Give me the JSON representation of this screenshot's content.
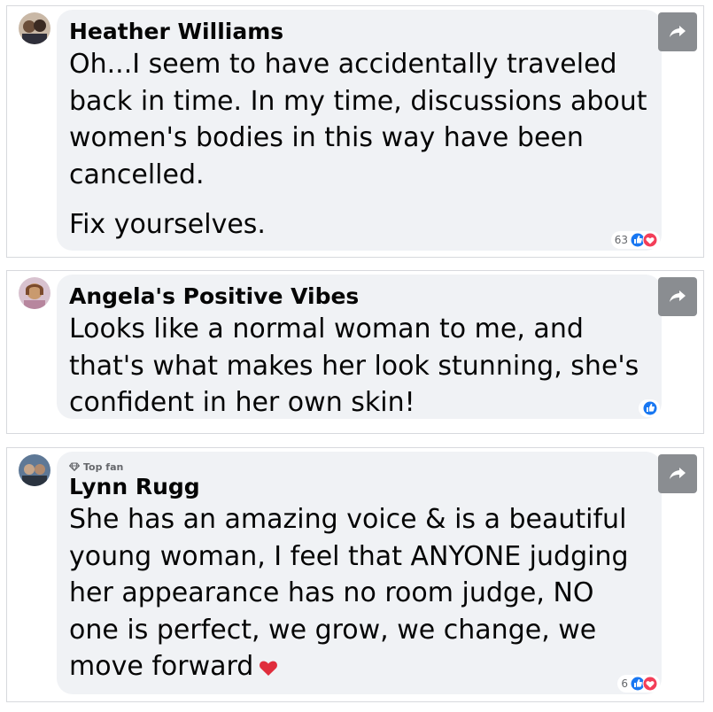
{
  "comments": [
    {
      "author": "Heather Williams",
      "paragraphs": [
        "Oh...I seem to have accidentally traveled back in time. In my time, discussions about women's bodies in this way have been cancelled.",
        "Fix yourselves."
      ],
      "reaction_count": "63",
      "reaction_icons": [
        "like-icon",
        "love-icon"
      ]
    },
    {
      "author": "Angela's Positive Vibes",
      "paragraphs": [
        "Looks like a normal woman to me, and that's what makes her look stunning, she's confident in her own skin!"
      ],
      "reaction_count": "",
      "reaction_icons": [
        "like-icon"
      ]
    },
    {
      "badge": "Top fan",
      "author": "Lynn Rugg",
      "paragraphs": [
        "She has an amazing voice & is a beautiful young woman, I feel that ANYONE judging her appearance has no room judge, NO one is perfect, we grow, we change, we move forward"
      ],
      "trailing_emoji": "heart",
      "reaction_count": "6",
      "reaction_icons": [
        "like-icon",
        "love-icon"
      ]
    }
  ],
  "colors": {
    "bubble": "#f0f2f5",
    "text": "#050505",
    "secondary_text": "#65676b",
    "like_blue": "#1877f2",
    "love_red": "#f33e58",
    "share_button": "#8a8d91"
  }
}
